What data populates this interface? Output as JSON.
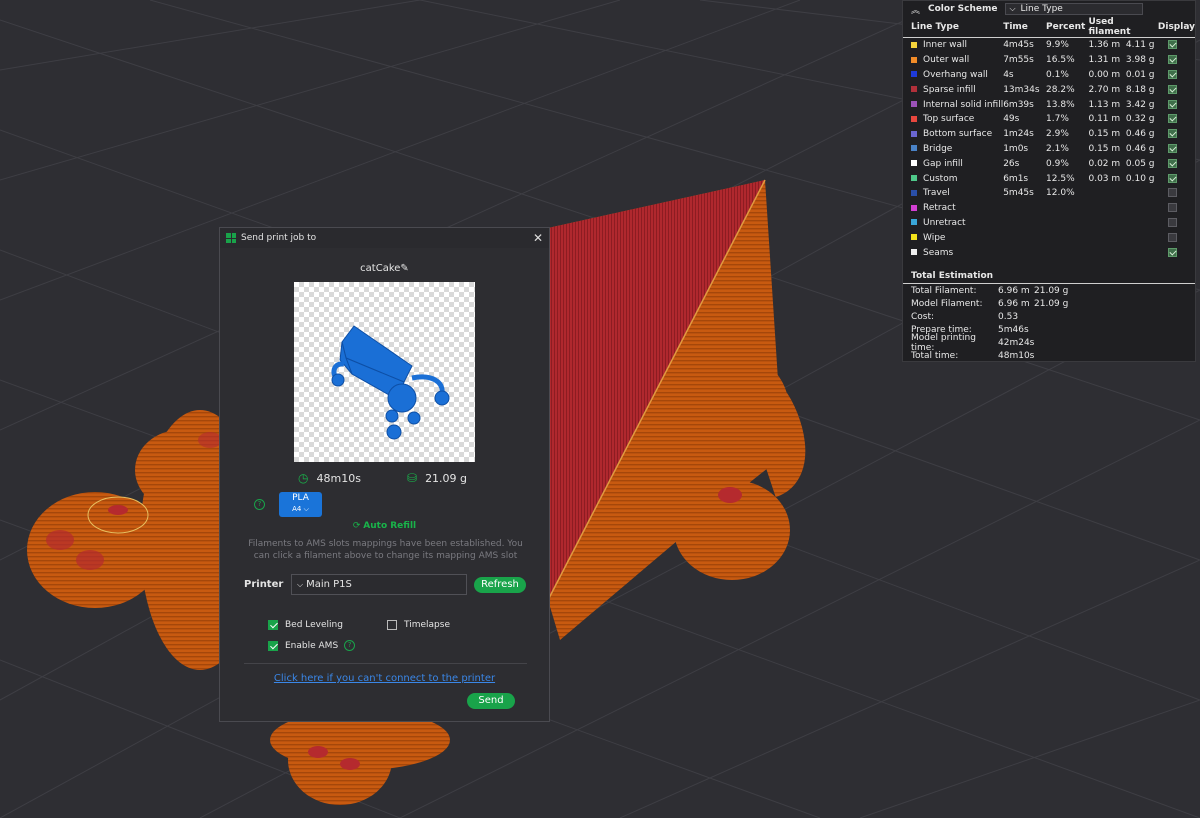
{
  "color_scheme": {
    "title": "Color Scheme",
    "selected": "Line Type",
    "columns": [
      "Line Type",
      "Time",
      "Percent",
      "Used filament",
      "Display"
    ],
    "rows": [
      {
        "name": "Inner wall",
        "color": "#f5d33b",
        "time": "4m45s",
        "percent": "9.9%",
        "length": "1.36 m",
        "weight": "4.11 g",
        "display": true
      },
      {
        "name": "Outer wall",
        "color": "#f28c28",
        "time": "7m55s",
        "percent": "16.5%",
        "length": "1.31 m",
        "weight": "3.98 g",
        "display": true
      },
      {
        "name": "Overhang wall",
        "color": "#1e3ad9",
        "time": "4s",
        "percent": "0.1%",
        "length": "0.00 m",
        "weight": "0.01 g",
        "display": true
      },
      {
        "name": "Sparse infill",
        "color": "#b1303a",
        "time": "13m34s",
        "percent": "28.2%",
        "length": "2.70 m",
        "weight": "8.18 g",
        "display": true
      },
      {
        "name": "Internal solid infill",
        "color": "#9b52b8",
        "time": "6m39s",
        "percent": "13.8%",
        "length": "1.13 m",
        "weight": "3.42 g",
        "display": true
      },
      {
        "name": "Top surface",
        "color": "#e8473e",
        "time": "49s",
        "percent": "1.7%",
        "length": "0.11 m",
        "weight": "0.32 g",
        "display": true
      },
      {
        "name": "Bottom surface",
        "color": "#6a66d1",
        "time": "1m24s",
        "percent": "2.9%",
        "length": "0.15 m",
        "weight": "0.46 g",
        "display": true
      },
      {
        "name": "Bridge",
        "color": "#4a82c6",
        "time": "1m0s",
        "percent": "2.1%",
        "length": "0.15 m",
        "weight": "0.46 g",
        "display": true
      },
      {
        "name": "Gap infill",
        "color": "#ffffff",
        "time": "26s",
        "percent": "0.9%",
        "length": "0.02 m",
        "weight": "0.05 g",
        "display": true
      },
      {
        "name": "Custom",
        "color": "#4fc98a",
        "time": "6m1s",
        "percent": "12.5%",
        "length": "0.03 m",
        "weight": "0.10 g",
        "display": true
      },
      {
        "name": "Travel",
        "color": "#2a4fa8",
        "time": "5m45s",
        "percent": "12.0%",
        "length": "",
        "weight": "",
        "display": false
      },
      {
        "name": "Retract",
        "color": "#d33fd3",
        "time": "",
        "percent": "",
        "length": "",
        "weight": "",
        "display": false
      },
      {
        "name": "Unretract",
        "color": "#3aa6d8",
        "time": "",
        "percent": "",
        "length": "",
        "weight": "",
        "display": false
      },
      {
        "name": "Wipe",
        "color": "#f2e21b",
        "time": "",
        "percent": "",
        "length": "",
        "weight": "",
        "display": false
      },
      {
        "name": "Seams",
        "color": "#f0f0f0",
        "time": "",
        "percent": "",
        "length": "",
        "weight": "",
        "display": true
      }
    ],
    "total_title": "Total Estimation",
    "totals": [
      {
        "label": "Total Filament:",
        "v1": "6.96 m",
        "v2": "21.09 g"
      },
      {
        "label": "Model Filament:",
        "v1": "6.96 m",
        "v2": "21.09 g"
      },
      {
        "label": "Cost:",
        "v1": "0.53",
        "v2": ""
      },
      {
        "label": "Prepare time:",
        "v1": "5m46s",
        "v2": ""
      },
      {
        "label": "Model printing time:",
        "v1": "42m24s",
        "v2": ""
      },
      {
        "label": "Total time:",
        "v1": "48m10s",
        "v2": ""
      }
    ]
  },
  "dialog": {
    "title": "Send print job to",
    "filename": "catCake",
    "print_time": "48m10s",
    "weight": "21.09 g",
    "filament_type": "PLA",
    "filament_slot": "A4",
    "filament_color": "#1a74d9",
    "auto_refill": "Auto Refill",
    "note": "Filaments to AMS slots mappings have been established. You can click a filament above to change its mapping AMS slot",
    "printer_label": "Printer",
    "printer_value": "Main P1S",
    "refresh_label": "Refresh",
    "bed_leveling": "Bed Leveling",
    "bed_leveling_checked": true,
    "timelapse": "Timelapse",
    "timelapse_checked": false,
    "enable_ams": "Enable AMS",
    "enable_ams_checked": true,
    "link": "Click here if you can't connect to the printer",
    "send_label": "Send"
  }
}
